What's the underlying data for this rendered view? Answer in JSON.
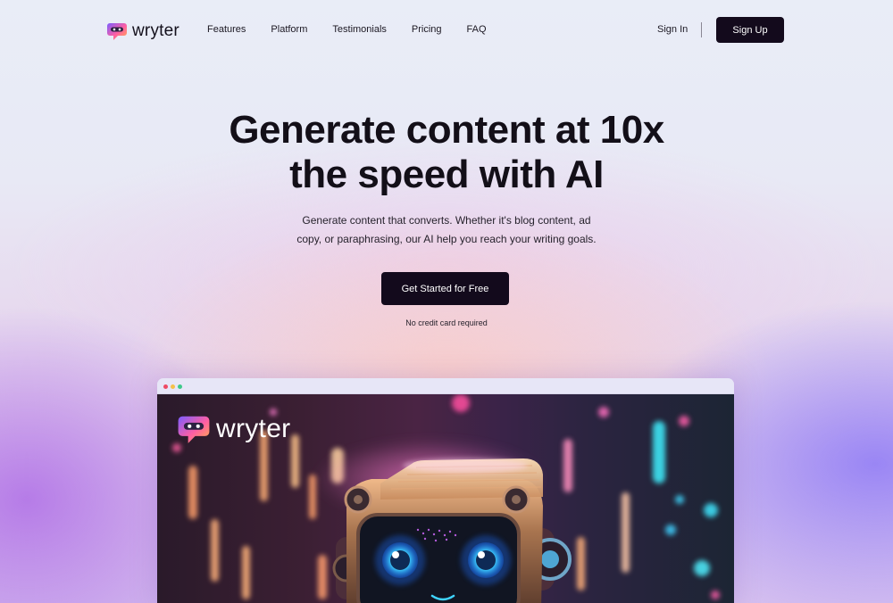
{
  "brand": {
    "name": "wryter"
  },
  "nav": {
    "links": [
      {
        "label": "Features"
      },
      {
        "label": "Platform"
      },
      {
        "label": "Testimonials"
      },
      {
        "label": "Pricing"
      },
      {
        "label": "FAQ"
      }
    ],
    "sign_in": "Sign In",
    "sign_up": "Sign Up"
  },
  "hero": {
    "title_line1": "Generate content at 10x",
    "title_line2": "the speed with AI",
    "subtitle_line1": "Generate content that converts. Whether it's blog content, ad",
    "subtitle_line2": "copy, or paraphrasing, our AI help you reach your writing goals.",
    "cta": "Get Started for Free",
    "note": "No credit card required"
  },
  "preview": {
    "logo_text": "wryter",
    "window_dots": [
      "red",
      "yellow",
      "green"
    ],
    "image_subject": "robot-illustration"
  },
  "colors": {
    "button_bg": "#130a1c",
    "text": "#14101c",
    "logo_gradient": [
      "#7b5cff",
      "#ff5fa2",
      "#ffb347"
    ]
  }
}
